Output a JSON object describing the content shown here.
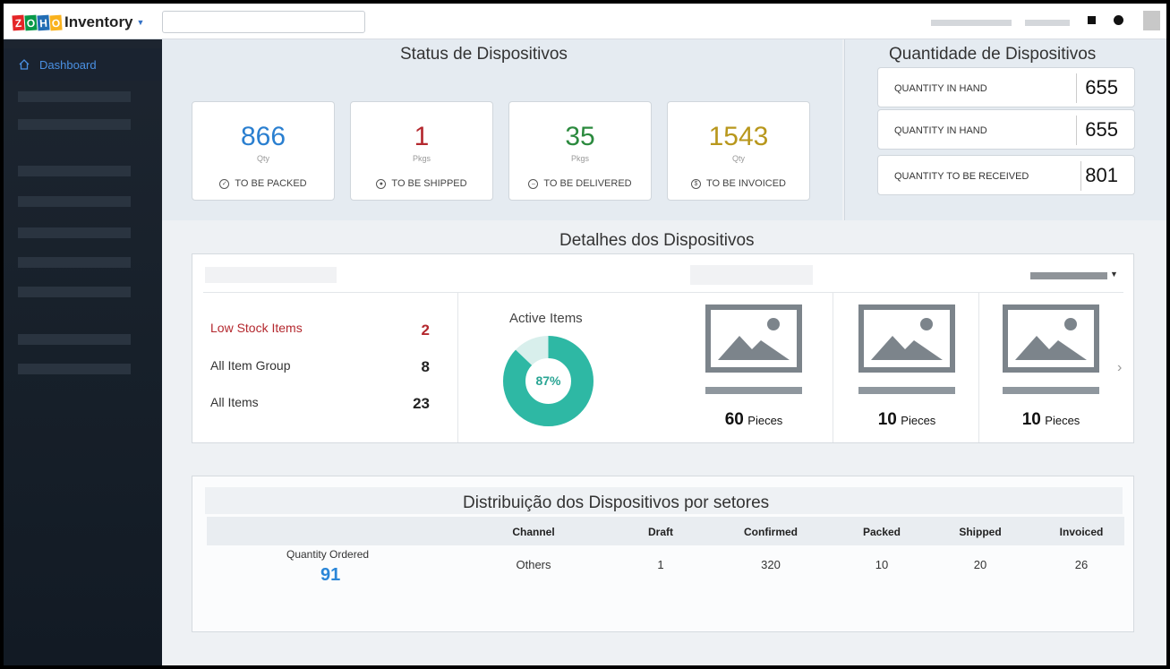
{
  "app": {
    "logo_letters": [
      "Z",
      "O",
      "H",
      "O"
    ],
    "name": "Inventory",
    "search_placeholder": ""
  },
  "sidebar": {
    "active_item": "Dashboard"
  },
  "status": {
    "title": "Status de Dispositivos",
    "cards": [
      {
        "value": "866",
        "unit": "Qty",
        "label": "TO BE PACKED",
        "color": "#2a7fd0",
        "icon": "check-circle-icon"
      },
      {
        "value": "1",
        "unit": "Pkgs",
        "label": "TO BE SHIPPED",
        "color": "#b4282e",
        "icon": "ship-circle-icon"
      },
      {
        "value": "35",
        "unit": "Pkgs",
        "label": "TO BE DELIVERED",
        "color": "#2b8a3e",
        "icon": "minus-circle-icon"
      },
      {
        "value": "1543",
        "unit": "Qty",
        "label": "TO BE INVOICED",
        "color": "#b8971c",
        "icon": "invoice-circle-icon"
      }
    ]
  },
  "quantity": {
    "title": "Quantidade de Dispositivos",
    "rows": [
      {
        "label": "QUANTITY IN HAND",
        "value": "655"
      },
      {
        "label": "QUANTITY IN HAND",
        "value": "655"
      },
      {
        "label": "QUANTITY TO BE RECEIVED",
        "value": "801"
      }
    ]
  },
  "details": {
    "title": "Detalhes dos Dispositivos",
    "stock": [
      {
        "label": "Low Stock Items",
        "value": "2",
        "color": "#b4282e"
      },
      {
        "label": "All Item Group",
        "value": "8",
        "color": "#333333"
      },
      {
        "label": "All Items",
        "value": "23",
        "color": "#333333"
      }
    ],
    "active_items": {
      "title": "Active Items",
      "percent_label": "87%",
      "percent": 87,
      "color": "#2eb8a4",
      "track_color": "#d8efec"
    },
    "products": [
      {
        "qty": "60",
        "unit": "Pieces"
      },
      {
        "qty": "10",
        "unit": "Pieces"
      },
      {
        "qty": "10",
        "unit": "Pieces"
      }
    ]
  },
  "distribution": {
    "title": "Distribuição dos Dispositivos por setores",
    "quantity_ordered_label": "Quantity Ordered",
    "quantity_ordered_value": "91",
    "headers": [
      "Channel",
      "Draft",
      "Confirmed",
      "Packed",
      "Shipped",
      "Invoiced"
    ],
    "row": [
      "Others",
      "1",
      "320",
      "10",
      "20",
      "26"
    ]
  }
}
